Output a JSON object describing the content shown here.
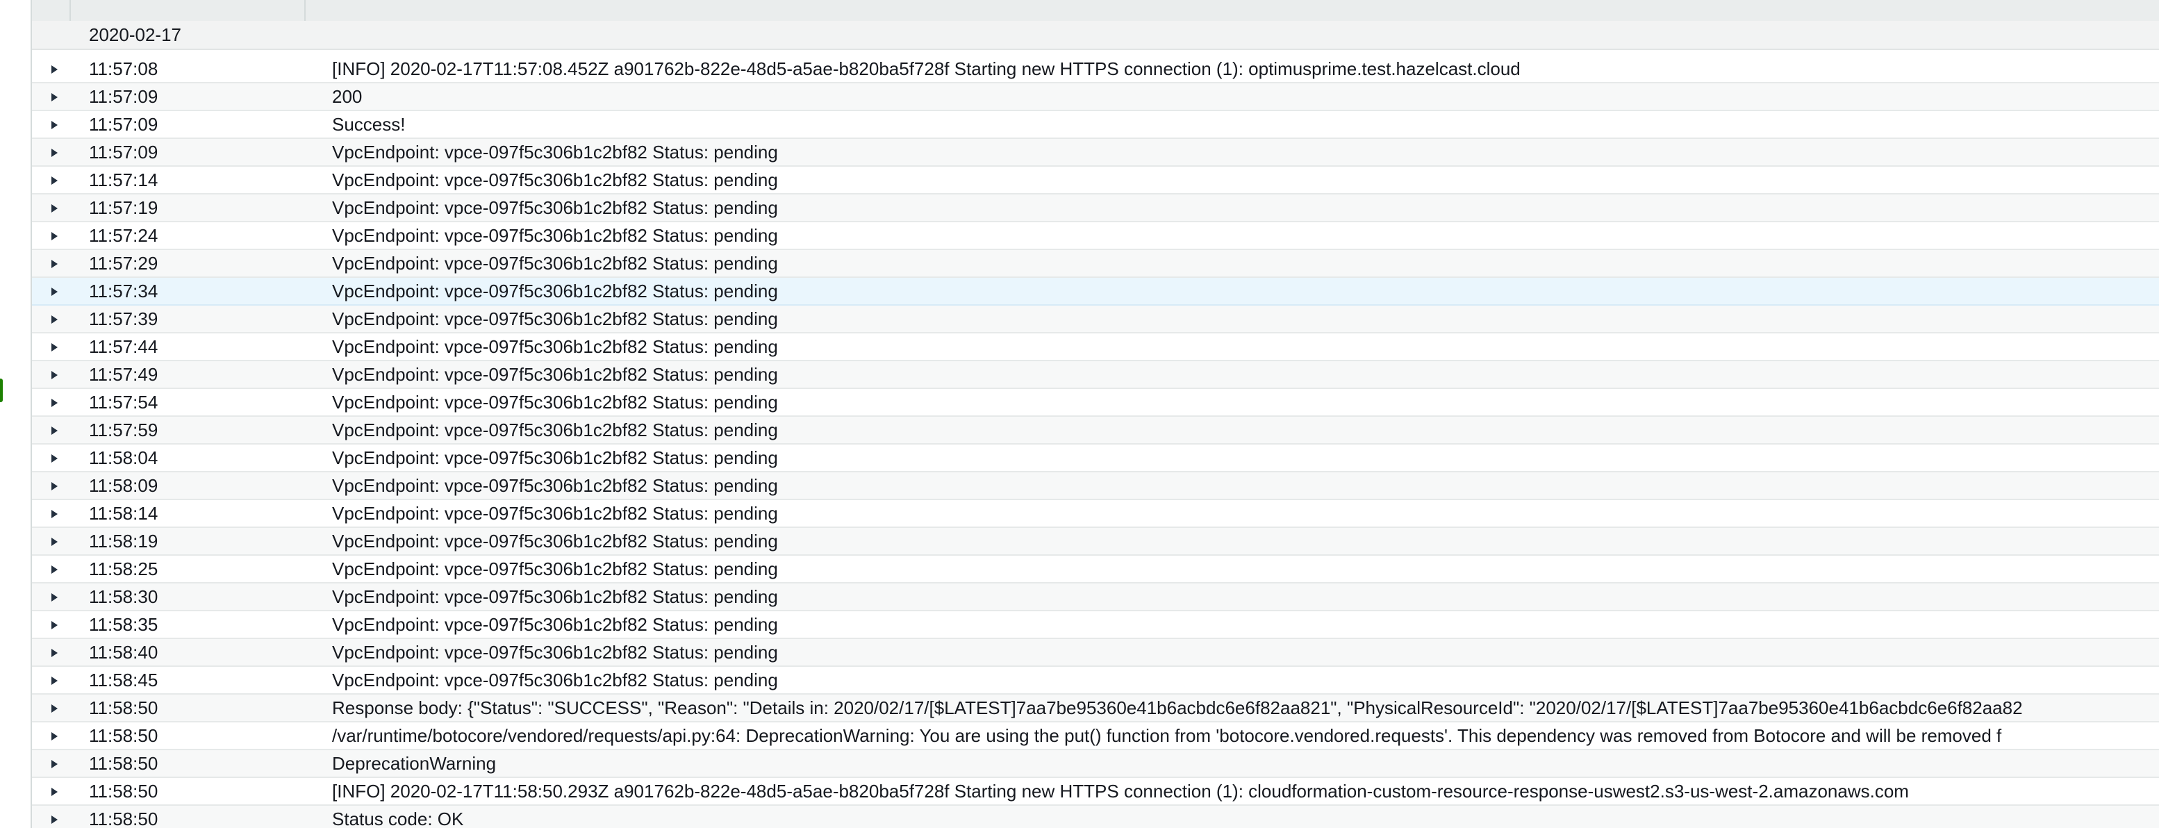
{
  "log_group": {
    "date": "2020-02-17",
    "rows": [
      {
        "time": "11:57:08",
        "message": "[INFO] 2020-02-17T11:57:08.452Z a901762b-822e-48d5-a5ae-b820ba5f728f Starting new HTTPS connection (1): optimusprime.test.hazelcast.cloud"
      },
      {
        "time": "11:57:09",
        "message": "200"
      },
      {
        "time": "11:57:09",
        "message": "Success!"
      },
      {
        "time": "11:57:09",
        "message": "VpcEndpoint: vpce-097f5c306b1c2bf82 Status: pending"
      },
      {
        "time": "11:57:14",
        "message": "VpcEndpoint: vpce-097f5c306b1c2bf82 Status: pending"
      },
      {
        "time": "11:57:19",
        "message": "VpcEndpoint: vpce-097f5c306b1c2bf82 Status: pending"
      },
      {
        "time": "11:57:24",
        "message": "VpcEndpoint: vpce-097f5c306b1c2bf82 Status: pending"
      },
      {
        "time": "11:57:29",
        "message": "VpcEndpoint: vpce-097f5c306b1c2bf82 Status: pending"
      },
      {
        "time": "11:57:34",
        "message": "VpcEndpoint: vpce-097f5c306b1c2bf82 Status: pending"
      },
      {
        "time": "11:57:39",
        "message": "VpcEndpoint: vpce-097f5c306b1c2bf82 Status: pending"
      },
      {
        "time": "11:57:44",
        "message": "VpcEndpoint: vpce-097f5c306b1c2bf82 Status: pending"
      },
      {
        "time": "11:57:49",
        "message": "VpcEndpoint: vpce-097f5c306b1c2bf82 Status: pending"
      },
      {
        "time": "11:57:54",
        "message": "VpcEndpoint: vpce-097f5c306b1c2bf82 Status: pending"
      },
      {
        "time": "11:57:59",
        "message": "VpcEndpoint: vpce-097f5c306b1c2bf82 Status: pending"
      },
      {
        "time": "11:58:04",
        "message": "VpcEndpoint: vpce-097f5c306b1c2bf82 Status: pending"
      },
      {
        "time": "11:58:09",
        "message": "VpcEndpoint: vpce-097f5c306b1c2bf82 Status: pending"
      },
      {
        "time": "11:58:14",
        "message": "VpcEndpoint: vpce-097f5c306b1c2bf82 Status: pending"
      },
      {
        "time": "11:58:19",
        "message": "VpcEndpoint: vpce-097f5c306b1c2bf82 Status: pending"
      },
      {
        "time": "11:58:25",
        "message": "VpcEndpoint: vpce-097f5c306b1c2bf82 Status: pending"
      },
      {
        "time": "11:58:30",
        "message": "VpcEndpoint: vpce-097f5c306b1c2bf82 Status: pending"
      },
      {
        "time": "11:58:35",
        "message": "VpcEndpoint: vpce-097f5c306b1c2bf82 Status: pending"
      },
      {
        "time": "11:58:40",
        "message": "VpcEndpoint: vpce-097f5c306b1c2bf82 Status: pending"
      },
      {
        "time": "11:58:45",
        "message": "VpcEndpoint: vpce-097f5c306b1c2bf82 Status: pending"
      },
      {
        "time": "11:58:50",
        "message": "Response body: {\"Status\": \"SUCCESS\", \"Reason\": \"Details in: 2020/02/17/[$LATEST]7aa7be95360e41b6acbdc6e6f82aa821\", \"PhysicalResourceId\": \"2020/02/17/[$LATEST]7aa7be95360e41b6acbdc6e6f82aa82"
      },
      {
        "time": "11:58:50",
        "message": "/var/runtime/botocore/vendored/requests/api.py:64: DeprecationWarning: You are using the put() function from 'botocore.vendored.requests'. This dependency was removed from Botocore and will be removed f"
      },
      {
        "time": "11:58:50",
        "message": "DeprecationWarning"
      },
      {
        "time": "11:58:50",
        "message": "[INFO] 2020-02-17T11:58:50.293Z a901762b-822e-48d5-a5ae-b820ba5f728f Starting new HTTPS connection (1): cloudformation-custom-resource-response-uswest2.s3-us-west-2.amazonaws.com"
      },
      {
        "time": "11:58:50",
        "message": "Status code: OK"
      }
    ]
  },
  "highlight_row_index": 8,
  "colors": {
    "header_bg": "#eaeded",
    "date_row_bg": "#f2f3f3",
    "row_alt_bg": "#f7f8f8",
    "row_highlight_bg": "#eaf6fd",
    "text": "#16191f",
    "accent_green": "#1d8102"
  }
}
